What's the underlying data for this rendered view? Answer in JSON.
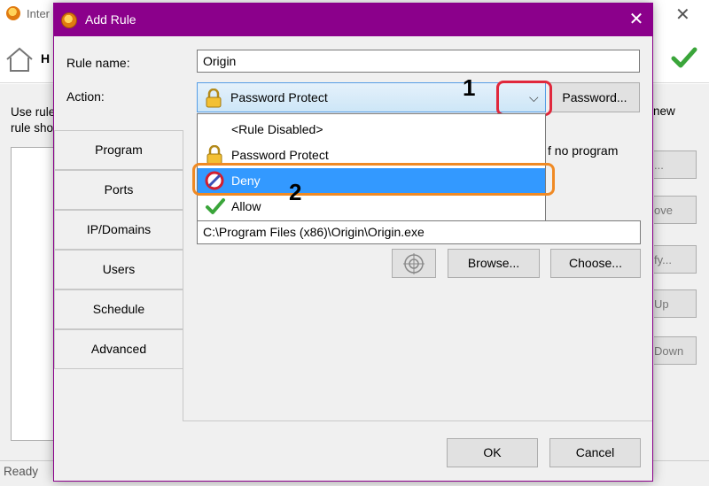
{
  "background": {
    "window_title": "Inter",
    "toolbar_label": "H",
    "description_line1": "Use rule",
    "description_line2": "rule sho",
    "description_right": "new",
    "side_buttons": [
      "...",
      "ove",
      "fy...",
      "Up",
      "Down"
    ],
    "status": "Ready"
  },
  "dialog": {
    "title": "Add Rule",
    "close_glyph": "✕",
    "rule_name_label": "Rule name:",
    "rule_name_value": "Origin",
    "action_label": "Action:",
    "action_value": "Password Protect",
    "chevron_glyph": "⌵",
    "password_button": "Password...",
    "dropdown_options": [
      "<Rule Disabled>",
      "Password Protect",
      "Deny",
      "Allow"
    ],
    "selected_option": "Deny",
    "annotations": {
      "one": "1",
      "two": "2"
    },
    "tabs": [
      "Program",
      "Ports",
      "IP/Domains",
      "Users",
      "Schedule",
      "Advanced"
    ],
    "active_tab": "Program",
    "program_hint": "f no program",
    "program_path": "C:\\Program Files (x86)\\Origin\\Origin.exe",
    "browse_button": "Browse...",
    "choose_button": "Choose...",
    "ok_button": "OK",
    "cancel_button": "Cancel"
  },
  "colors": {
    "dialog_title_bar": "#8b008b",
    "selection": "#3399ff",
    "annotation_red": "#e0283c",
    "annotation_orange": "#f08a24"
  }
}
